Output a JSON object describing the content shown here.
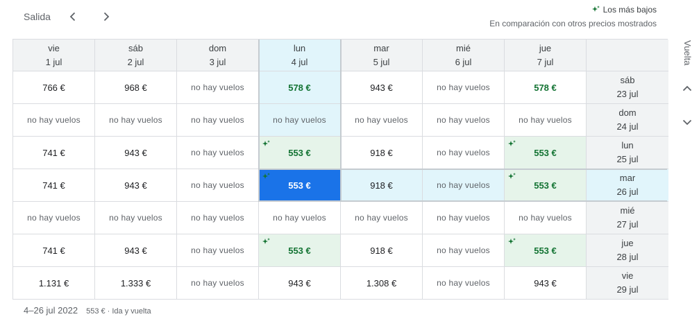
{
  "header": {
    "salida_label": "Salida",
    "legend_title": "Los más bajos",
    "legend_subtitle": "En comparación con otros precios mostrados",
    "vuelta_label": "Vuelta"
  },
  "colors": {
    "low": "#137333",
    "low_bg": "#e6f4ea",
    "selected": "#1a73e8",
    "highlight_bg": "#e1f5fb"
  },
  "columns": [
    {
      "day": "vie",
      "date": "1 jul"
    },
    {
      "day": "sáb",
      "date": "2 jul"
    },
    {
      "day": "dom",
      "date": "3 jul"
    },
    {
      "day": "lun",
      "date": "4 jul"
    },
    {
      "day": "mar",
      "date": "5 jul"
    },
    {
      "day": "mié",
      "date": "6 jul"
    },
    {
      "day": "jue",
      "date": "7 jul"
    }
  ],
  "rows": [
    {
      "day": "sáb",
      "date": "23 jul",
      "cells": [
        {
          "price": "766 €"
        },
        {
          "price": "968 €"
        },
        {
          "price": "no hay vuelos",
          "none": true
        },
        {
          "price": "578 €",
          "low": true
        },
        {
          "price": "943 €"
        },
        {
          "price": "no hay vuelos",
          "none": true
        },
        {
          "price": "578 €",
          "low": true
        }
      ]
    },
    {
      "day": "dom",
      "date": "24 jul",
      "cells": [
        {
          "price": "no hay vuelos",
          "none": true
        },
        {
          "price": "no hay vuelos",
          "none": true
        },
        {
          "price": "no hay vuelos",
          "none": true
        },
        {
          "price": "no hay vuelos",
          "none": true
        },
        {
          "price": "no hay vuelos",
          "none": true
        },
        {
          "price": "no hay vuelos",
          "none": true
        },
        {
          "price": "no hay vuelos",
          "none": true
        }
      ]
    },
    {
      "day": "lun",
      "date": "25 jul",
      "cells": [
        {
          "price": "741 €"
        },
        {
          "price": "943 €"
        },
        {
          "price": "no hay vuelos",
          "none": true
        },
        {
          "price": "553 €",
          "lowest": true
        },
        {
          "price": "918 €"
        },
        {
          "price": "no hay vuelos",
          "none": true
        },
        {
          "price": "553 €",
          "lowest": true
        }
      ]
    },
    {
      "day": "mar",
      "date": "26 jul",
      "cells": [
        {
          "price": "741 €"
        },
        {
          "price": "943 €"
        },
        {
          "price": "no hay vuelos",
          "none": true
        },
        {
          "price": "553 €",
          "selected": true,
          "lowest": true
        },
        {
          "price": "918 €"
        },
        {
          "price": "no hay vuelos",
          "none": true
        },
        {
          "price": "553 €",
          "lowest": true
        }
      ]
    },
    {
      "day": "mié",
      "date": "27 jul",
      "cells": [
        {
          "price": "no hay vuelos",
          "none": true
        },
        {
          "price": "no hay vuelos",
          "none": true
        },
        {
          "price": "no hay vuelos",
          "none": true
        },
        {
          "price": "no hay vuelos",
          "none": true
        },
        {
          "price": "no hay vuelos",
          "none": true
        },
        {
          "price": "no hay vuelos",
          "none": true
        },
        {
          "price": "no hay vuelos",
          "none": true
        }
      ]
    },
    {
      "day": "jue",
      "date": "28 jul",
      "cells": [
        {
          "price": "741 €"
        },
        {
          "price": "943 €"
        },
        {
          "price": "no hay vuelos",
          "none": true
        },
        {
          "price": "553 €",
          "lowest": true
        },
        {
          "price": "918 €"
        },
        {
          "price": "no hay vuelos",
          "none": true
        },
        {
          "price": "553 €",
          "lowest": true
        }
      ]
    },
    {
      "day": "vie",
      "date": "29 jul",
      "cells": [
        {
          "price": "1.131 €"
        },
        {
          "price": "1.333 €"
        },
        {
          "price": "no hay vuelos",
          "none": true
        },
        {
          "price": "943 €"
        },
        {
          "price": "1.308 €"
        },
        {
          "price": "no hay vuelos",
          "none": true
        },
        {
          "price": "943 €"
        }
      ]
    }
  ],
  "selection": {
    "column": 3,
    "row": 3
  },
  "footer": {
    "dates": "4–26 jul 2022",
    "summary": "553 € · Ida y vuelta"
  }
}
